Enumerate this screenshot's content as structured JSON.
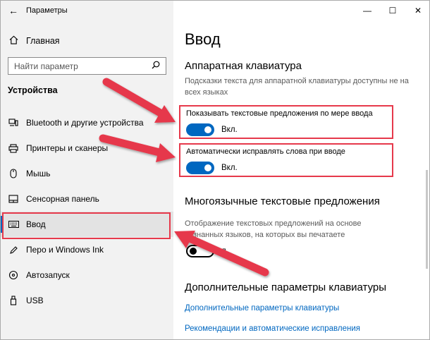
{
  "app": {
    "title": "Параметры"
  },
  "sidebar": {
    "home": {
      "label": "Главная"
    },
    "search": {
      "placeholder": "Найти параметр"
    },
    "section_title": "Устройства",
    "items": [
      {
        "label": "Bluetooth и другие устройства",
        "icon": "bluetooth-devices-icon"
      },
      {
        "label": "Принтеры и сканеры",
        "icon": "printer-icon"
      },
      {
        "label": "Мышь",
        "icon": "mouse-icon"
      },
      {
        "label": "Сенсорная панель",
        "icon": "touchpad-icon"
      },
      {
        "label": "Ввод",
        "icon": "keyboard-icon",
        "active": true
      },
      {
        "label": "Перо и Windows Ink",
        "icon": "pen-icon"
      },
      {
        "label": "Автозапуск",
        "icon": "autoplay-icon"
      },
      {
        "label": "USB",
        "icon": "usb-icon"
      }
    ]
  },
  "main": {
    "title": "Ввод",
    "hardware_keyboard": {
      "heading": "Аппаратная клавиатура",
      "description": "Подсказки текста для аппаратной клавиатуры доступны не на всех языках",
      "option1": {
        "label": "Показывать текстовые предложения по мере ввода",
        "state": "Вкл."
      },
      "option2": {
        "label": "Автоматически исправлять слова при вводе",
        "state": "Вкл."
      }
    },
    "multilingual": {
      "heading": "Многоязычные текстовые предложения",
      "description_line1": "Отображение текстовых предложений на основе",
      "description_line2": "познанных языков, на которых вы печатаете",
      "state": "л."
    },
    "advanced": {
      "heading": "Дополнительные параметры клавиатуры",
      "links": [
        "Дополнительные параметры клавиатуры",
        "Рекомендации и автоматические исправления"
      ]
    }
  },
  "colors": {
    "accent": "#0067c0",
    "annotation": "#e6394b",
    "sidebar_bg": "#f2f2f2"
  }
}
